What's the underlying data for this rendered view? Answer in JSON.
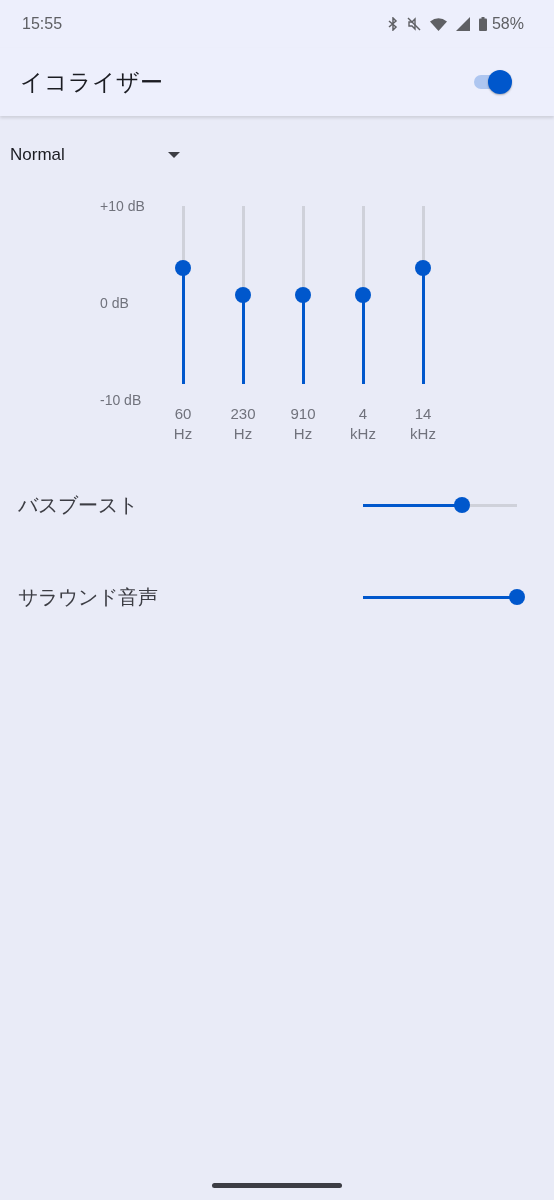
{
  "status_bar": {
    "time": "15:55",
    "battery": "58%"
  },
  "app_bar": {
    "title": "イコライザー",
    "enabled": true
  },
  "preset": {
    "value": "Normal"
  },
  "scale": [
    "+10 dB",
    "0 dB",
    "-10 dB"
  ],
  "bands": [
    {
      "value": "60",
      "unit": "Hz",
      "level": 0.65
    },
    {
      "value": "230",
      "unit": "Hz",
      "level": 0.5
    },
    {
      "value": "910",
      "unit": "Hz",
      "level": 0.5
    },
    {
      "value": "4",
      "unit": "kHz",
      "level": 0.5
    },
    {
      "value": "14",
      "unit": "kHz",
      "level": 0.65
    }
  ],
  "effects": [
    {
      "label": "バスブースト",
      "level": 0.64
    },
    {
      "label": "サラウンド音声",
      "level": 1.0
    }
  ]
}
